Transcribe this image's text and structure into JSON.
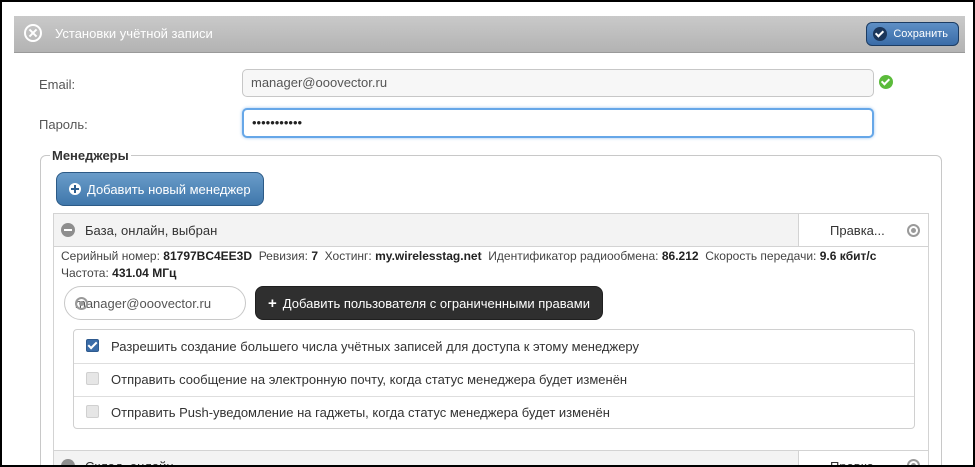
{
  "dialog": {
    "title": "Установки учётной записи",
    "save_label": "Сохранить"
  },
  "form": {
    "email_label": "Email:",
    "email_value": "manager@ooovector.ru",
    "password_label": "Пароль:",
    "password_value": "•••••••••••"
  },
  "managers": {
    "legend": "Менеджеры",
    "add_button": "Добавить новый менеджер",
    "items": [
      {
        "name": "База, онлайн, выбран",
        "edit_label": "Правка...",
        "serial_label": "Серийный номер:",
        "serial_value": "81797BC4EE3D",
        "revision_label": "Ревизия:",
        "revision_value": "7",
        "hosting_label": "Хостинг:",
        "hosting_value": "my.wirelesstag.net",
        "radio_id_label": "Идентификатор радиообмена:",
        "radio_id_value": "86.212",
        "speed_label": "Скорость передачи:",
        "speed_value": "9.6 кбит/с",
        "freq_label": "Частота:",
        "freq_value": "431.04 МГц",
        "user_email": "manager@ooovector.ru",
        "add_user_button": "Добавить пользователя с ограниченными правами",
        "options": [
          {
            "label": "Разрешить создание большего числа учётных записей для доступа к этому менеджеру",
            "checked": true
          },
          {
            "label": "Отправить сообщение на электронную почту, когда статус менеджера будет изменён",
            "checked": false
          },
          {
            "label": "Отправить Push-уведомление на гаджеты, когда статус менеджера будет изменён",
            "checked": false
          }
        ]
      },
      {
        "name": "Склад, онлайн",
        "edit_label": "Правка..."
      }
    ]
  }
}
